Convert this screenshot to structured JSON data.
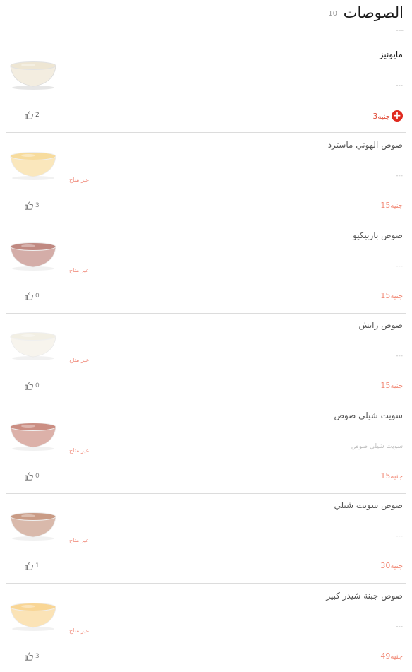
{
  "section": {
    "title": "الصوصات",
    "count": "10",
    "description": "---"
  },
  "currency": "جنيه",
  "items": [
    {
      "name": "مايونيز",
      "description": "---",
      "price": "3",
      "likes": "2",
      "available": true,
      "status": "",
      "sauce_color": "#eee6d3",
      "icons": [
        "add-icon",
        "thumbs-up-icon"
      ]
    },
    {
      "name": "صوص الهوني ماسترد",
      "description": "---",
      "price": "15",
      "likes": "3",
      "available": false,
      "status": "غير متاح",
      "sauce_color": "#f2c050"
    },
    {
      "name": "صوص باربيكيو",
      "description": "---",
      "price": "15",
      "likes": "0",
      "available": false,
      "status": "غير متاح",
      "sauce_color": "#8e2a1c"
    },
    {
      "name": "صوص رانش",
      "description": "---",
      "price": "15",
      "likes": "0",
      "available": false,
      "status": "غير متاح",
      "sauce_color": "#e9e2cf"
    },
    {
      "name": "سويت شيلي صوص",
      "description": "سويت شيلي صوص",
      "price": "15",
      "likes": "0",
      "available": false,
      "status": "غير متاح",
      "sauce_color": "#a2331e"
    },
    {
      "name": "صوص سويت شيلي",
      "description": "---",
      "price": "30",
      "likes": "1",
      "available": false,
      "status": "غير متاح",
      "sauce_color": "#9e4a23"
    },
    {
      "name": "صوص جبنة شيدر كبير",
      "description": "---",
      "price": "49",
      "likes": "3",
      "available": false,
      "status": "غير متاح",
      "sauce_color": "#f5b540"
    }
  ]
}
